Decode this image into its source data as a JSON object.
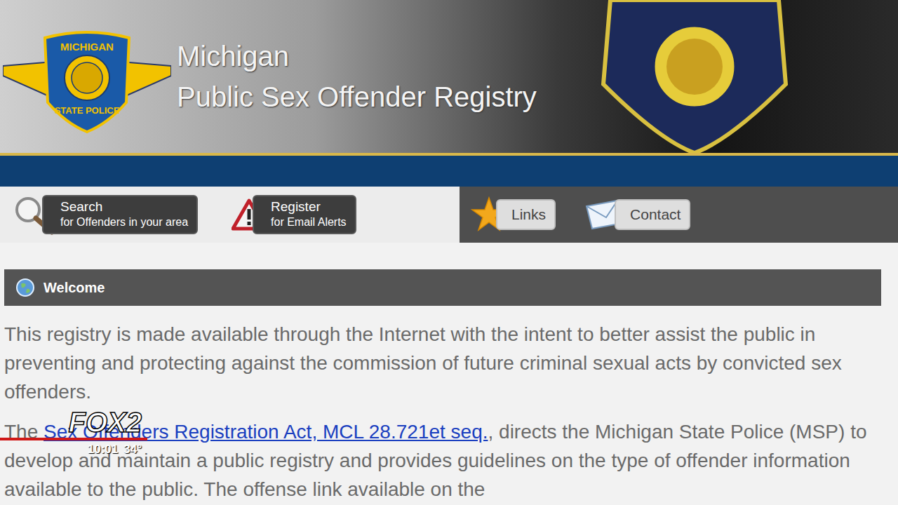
{
  "logo": {
    "top": "MICHIGAN",
    "bottom": "STATE POLICE"
  },
  "header": {
    "title_line1": "Michigan",
    "title_line2": "Public Sex Offender Registry"
  },
  "nav": [
    {
      "title": "Search",
      "subtitle": "for Offenders in your area",
      "kind": "primary",
      "icon": "search"
    },
    {
      "title": "Register",
      "subtitle": "for Email Alerts",
      "kind": "primary",
      "icon": "warning"
    },
    {
      "title": "Links",
      "subtitle": "",
      "kind": "secondary",
      "icon": "star"
    },
    {
      "title": "Contact",
      "subtitle": "",
      "kind": "secondary",
      "icon": "mail"
    }
  ],
  "welcome": {
    "heading": "Welcome"
  },
  "intro": "This registry is made available through the Internet with the intent to better assist the public in preventing and protecting against the commission of future criminal sexual acts by convicted sex offenders.",
  "act": {
    "before": "The ",
    "link": "Sex Offenders Registration Act, MCL 28.721et seq.",
    "after": ", directs the Michigan State Police (MSP) to develop and maintain a public registry and provides guidelines on the type of offender information available to the public. The offense link available on the"
  },
  "overlay": {
    "channel": "FOX2",
    "time": "10:01",
    "temperature": "34°"
  }
}
